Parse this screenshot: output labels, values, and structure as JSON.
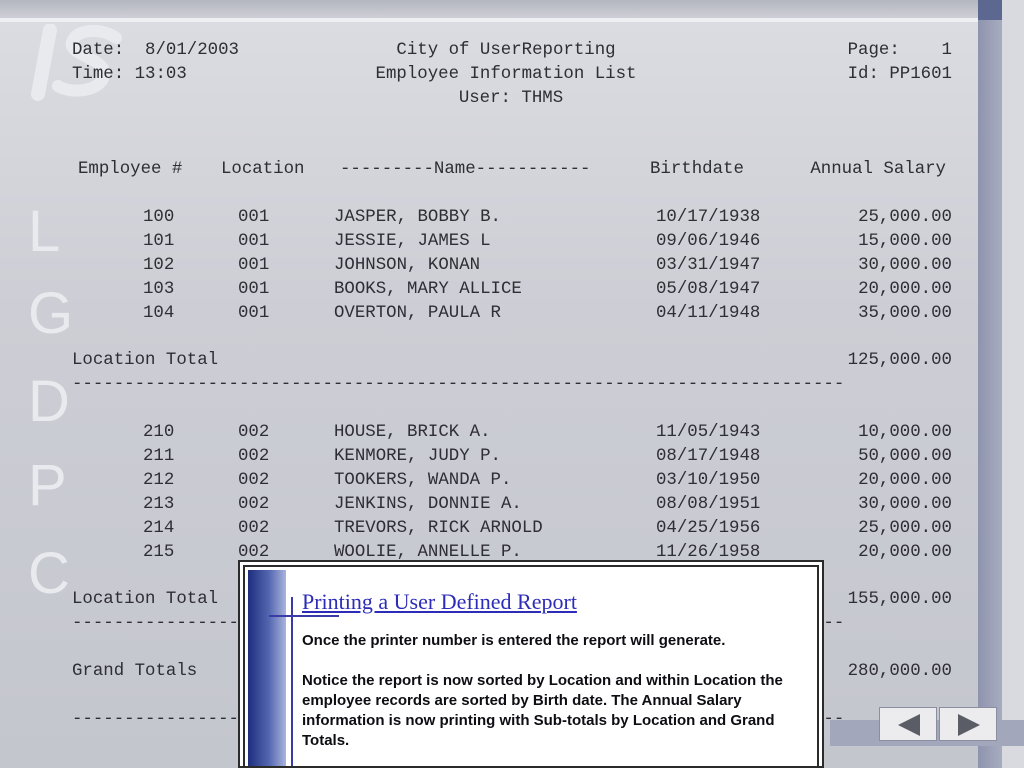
{
  "watermark": {
    "letters": [
      "L",
      "G",
      "D",
      "P",
      "C"
    ]
  },
  "report": {
    "header": {
      "date": "Date:  8/01/2003",
      "time": "Time: 13:03",
      "org": "City of UserReporting",
      "title": "Employee Information List",
      "user": "User: THMS",
      "page": "Page:    1",
      "id": "Id: PP1601"
    },
    "columns": [
      "Employee #",
      "Location",
      "---------Name-----------",
      "Birthdate",
      "Annual Salary"
    ],
    "group1": [
      {
        "emp": "100",
        "loc": "001",
        "name": "JASPER, BOBBY B.",
        "birth": "10/17/1938",
        "salary": "25,000.00"
      },
      {
        "emp": "101",
        "loc": "001",
        "name": "JESSIE, JAMES L",
        "birth": "09/06/1946",
        "salary": "15,000.00"
      },
      {
        "emp": "102",
        "loc": "001",
        "name": "JOHNSON, KONAN",
        "birth": "03/31/1947",
        "salary": "30,000.00"
      },
      {
        "emp": "103",
        "loc": "001",
        "name": "BOOKS, MARY ALLICE",
        "birth": "05/08/1947",
        "salary": "20,000.00"
      },
      {
        "emp": "104",
        "loc": "001",
        "name": "OVERTON, PAULA R",
        "birth": "04/11/1948",
        "salary": "35,000.00"
      }
    ],
    "group1_total": {
      "label": "Location Total",
      "value": "125,000.00"
    },
    "group2": [
      {
        "emp": "210",
        "loc": "002",
        "name": "HOUSE, BRICK A.",
        "birth": "11/05/1943",
        "salary": "10,000.00"
      },
      {
        "emp": "211",
        "loc": "002",
        "name": "KENMORE, JUDY P.",
        "birth": "08/17/1948",
        "salary": "50,000.00"
      },
      {
        "emp": "212",
        "loc": "002",
        "name": "TOOKERS, WANDA P.",
        "birth": "03/10/1950",
        "salary": "20,000.00"
      },
      {
        "emp": "213",
        "loc": "002",
        "name": "JENKINS, DONNIE A.",
        "birth": "08/08/1951",
        "salary": "30,000.00"
      },
      {
        "emp": "214",
        "loc": "002",
        "name": "TREVORS, RICK ARNOLD",
        "birth": "04/25/1956",
        "salary": "25,000.00"
      },
      {
        "emp": "215",
        "loc": "002",
        "name": "WOOLIE, ANNELLE P.",
        "birth": "11/26/1958",
        "salary": "20,000.00"
      }
    ],
    "group2_total": {
      "label": "Location Total",
      "value": "155,000.00"
    },
    "grand_total": {
      "label": "Grand Totals",
      "value": "280,000.00"
    },
    "separator": "--------------------------------------------------------------------------"
  },
  "popup": {
    "title": "Printing a User Defined Report",
    "paragraphs": [
      "Once the printer number is entered the report will generate.",
      "Notice the report is now sorted by Location and within Location the employee records are sorted by Birth date.  The Annual Salary information is now printing with Sub-totals by Location and Grand Totals."
    ]
  },
  "nav": {
    "prev_icon": "arrow-left-icon",
    "next_icon": "arrow-right-icon"
  }
}
